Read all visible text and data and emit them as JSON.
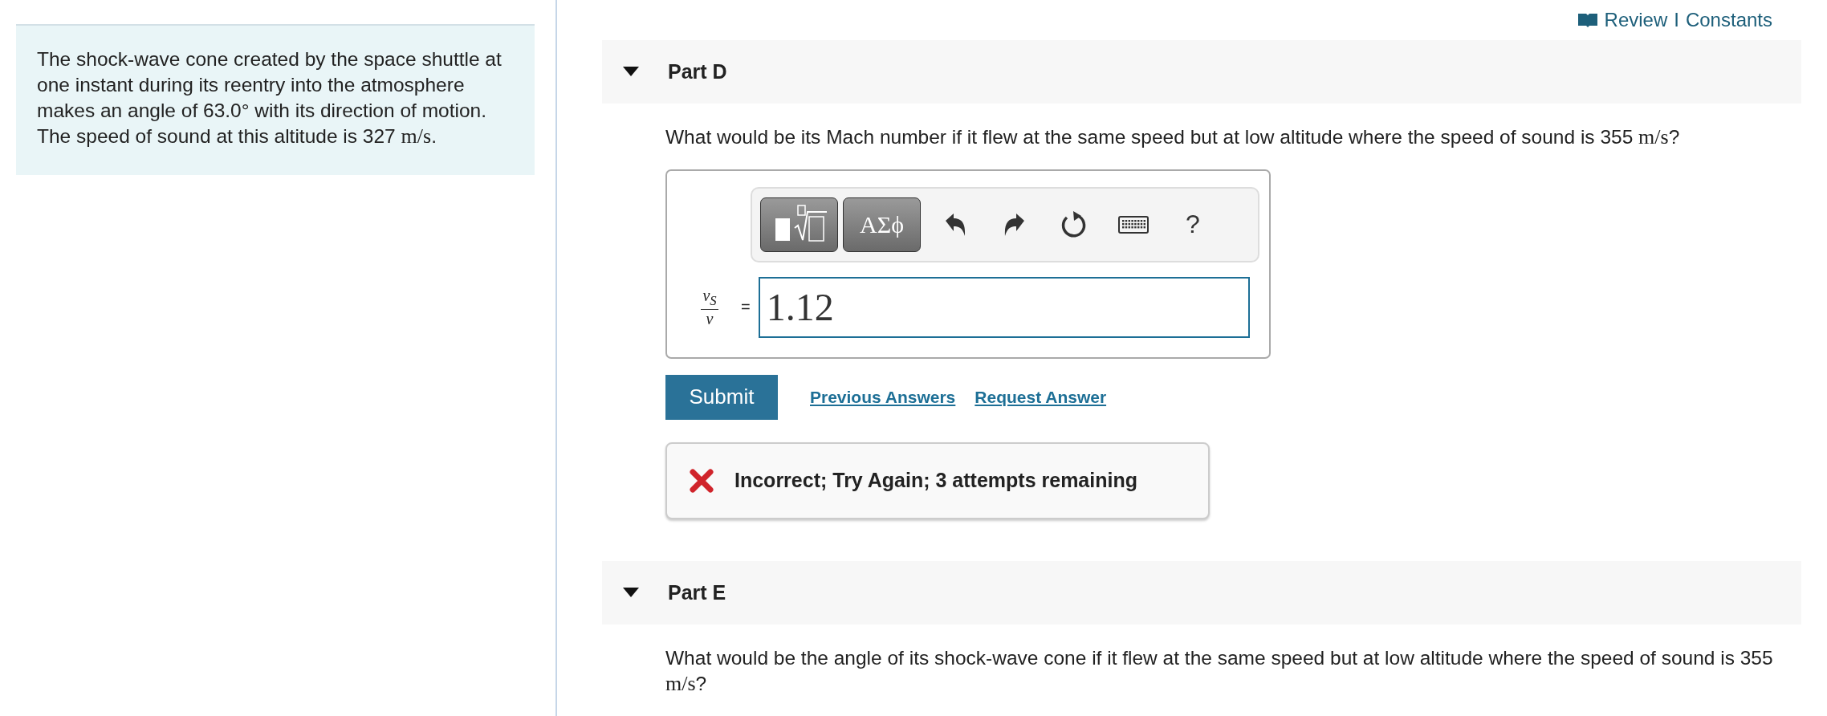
{
  "problem": {
    "intro": [
      {
        "kind": "text",
        "text": "The shock-wave cone created by the space shuttle at one instant during its reentry into the atmosphere makes an angle of 63.0° with its direction of motion. The speed of sound at this altitude is 327 "
      },
      {
        "kind": "math",
        "text": "m/s"
      },
      {
        "kind": "text",
        "text": "."
      }
    ]
  },
  "header_links": [
    {
      "label": "Review"
    },
    {
      "label": "Constants"
    }
  ],
  "header_separator": "I",
  "parts": [
    {
      "title": "Part D",
      "expanded": true,
      "question": [
        {
          "kind": "text",
          "text": "What would be its Mach number if it flew at the same speed but at low altitude where the speed of sound is 355 "
        },
        {
          "kind": "math",
          "text": "m/s"
        },
        {
          "kind": "text",
          "text": "?"
        }
      ],
      "answer": {
        "toolbar": [
          {
            "kind": "templates"
          },
          {
            "kind": "greek",
            "label": "ΑΣϕ"
          },
          {
            "kind": "undo"
          },
          {
            "kind": "redo"
          },
          {
            "kind": "reset"
          },
          {
            "kind": "keyboard"
          },
          {
            "kind": "help",
            "label": "?"
          }
        ],
        "variable": {
          "numerator": "v",
          "numerator_sub": "S",
          "denominator": "v",
          "equals": "="
        },
        "value": "1.12"
      },
      "submit": "Submit",
      "links": [
        "Previous Answers",
        "Request Answer"
      ],
      "feedback": {
        "correct": false,
        "text": "Incorrect; Try Again; 3 attempts remaining"
      }
    },
    {
      "title": "Part E",
      "expanded": true,
      "question": [
        {
          "kind": "text",
          "text": "What would be the angle of its shock-wave cone if it flew at the same speed but at low altitude where the speed of sound is 355 "
        },
        {
          "kind": "math",
          "text": "m/s"
        },
        {
          "kind": "text",
          "text": "?"
        }
      ]
    }
  ]
}
